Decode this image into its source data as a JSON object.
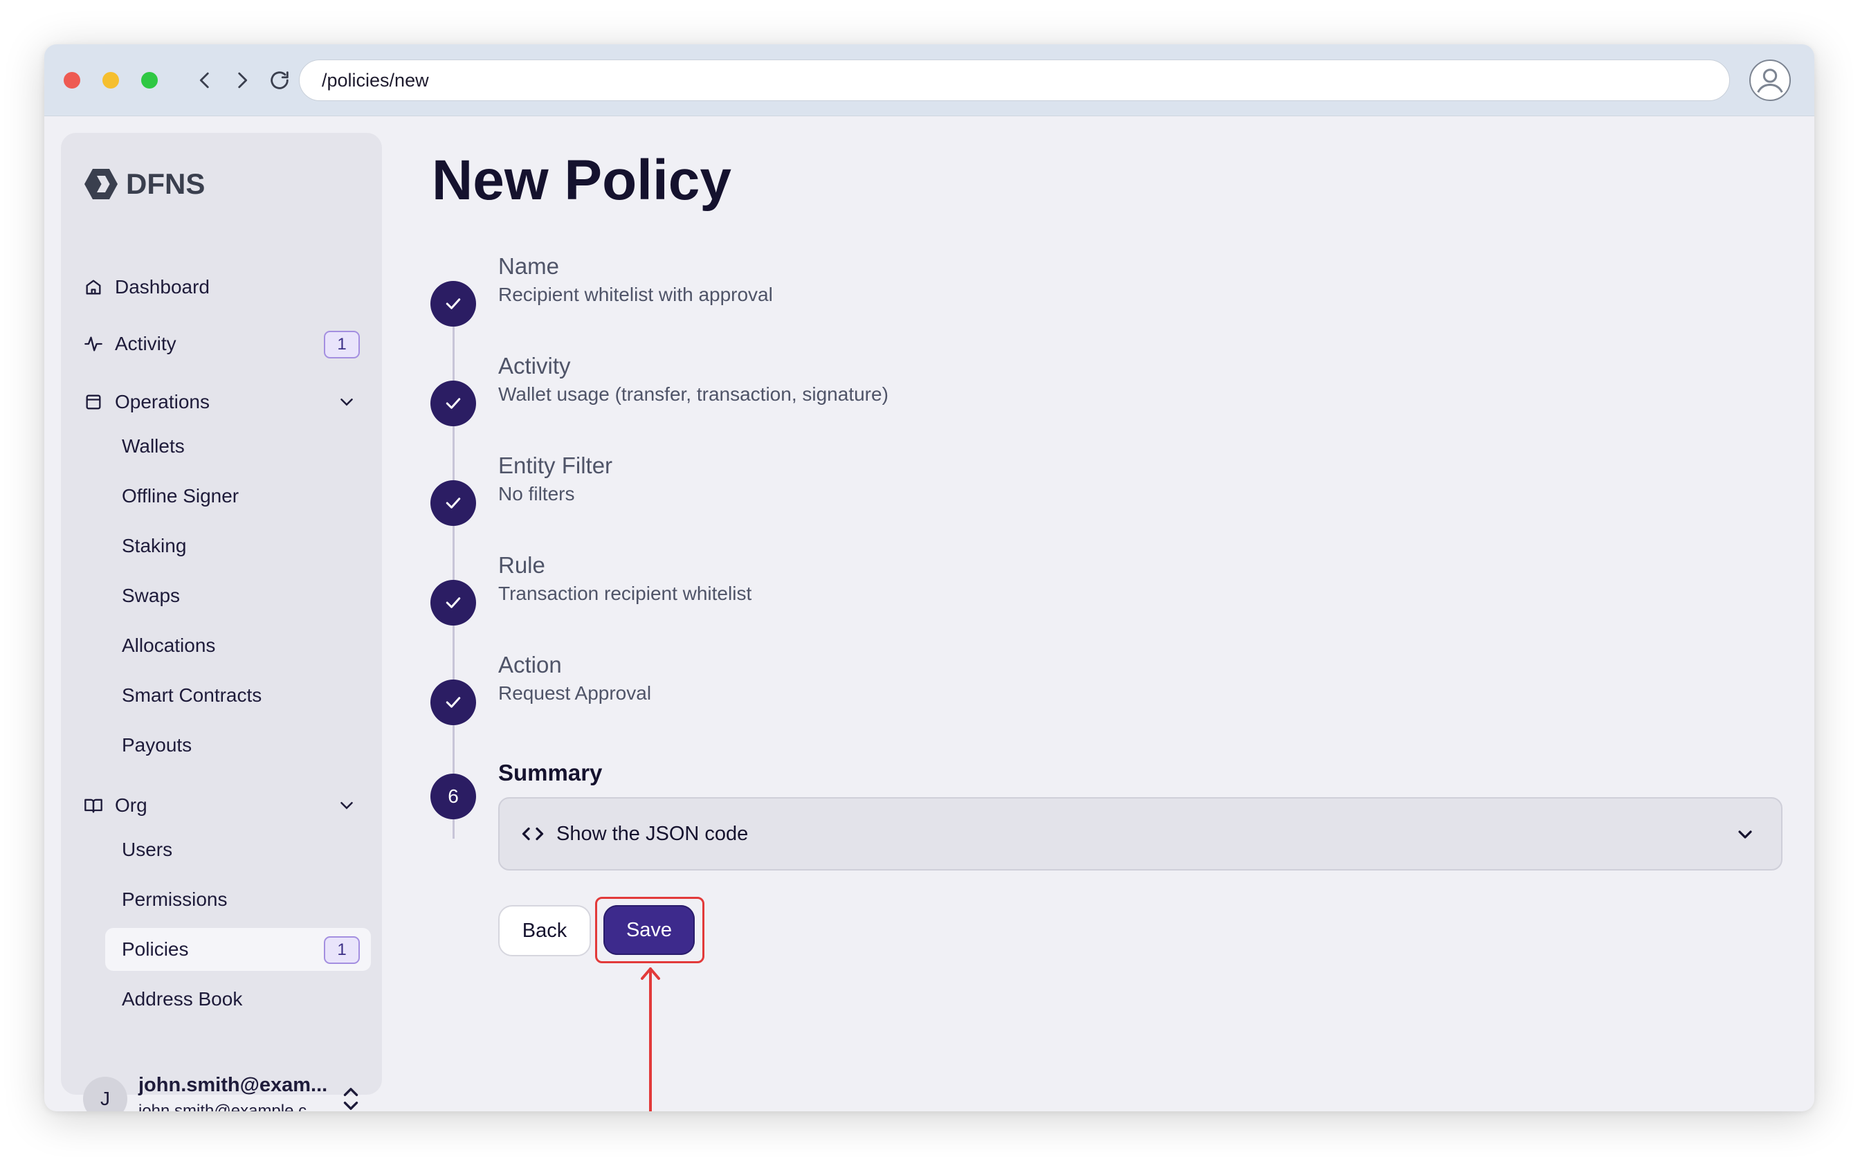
{
  "browser": {
    "url": "/policies/new"
  },
  "sidebar": {
    "logo_text": "DFNS",
    "dashboard": "Dashboard",
    "activity": {
      "label": "Activity",
      "badge": "1"
    },
    "operations": {
      "label": "Operations",
      "items": [
        "Wallets",
        "Offline Signer",
        "Staking",
        "Swaps",
        "Allocations",
        "Smart Contracts",
        "Payouts"
      ]
    },
    "org": {
      "label": "Org",
      "items": [
        "Users",
        "Permissions",
        "Policies",
        "Address Book"
      ],
      "policies_badge": "1"
    },
    "user": {
      "initial": "J",
      "name": "john.smith@exam...",
      "email": "john.smith@example.c..."
    }
  },
  "main": {
    "title": "New Policy",
    "steps": [
      {
        "title": "Name",
        "value": "Recipient whitelist with approval"
      },
      {
        "title": "Activity",
        "value": "Wallet usage (transfer, transaction, signature)"
      },
      {
        "title": "Entity Filter",
        "value": "No filters"
      },
      {
        "title": "Rule",
        "value": "Transaction recipient whitelist"
      },
      {
        "title": "Action",
        "value": "Request Approval"
      }
    ],
    "summary": {
      "number": "6",
      "title": "Summary",
      "json_toggle_label": "Show the JSON code"
    },
    "buttons": {
      "back": "Back",
      "save": "Save"
    }
  },
  "colors": {
    "accent": "#3d2a8c",
    "step_circle": "#2b1d63",
    "highlight": "#e23a3a"
  }
}
